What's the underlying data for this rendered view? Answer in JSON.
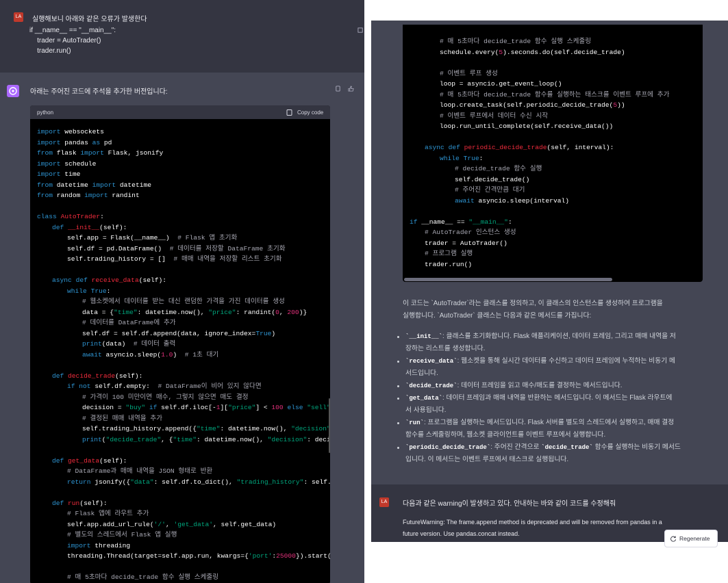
{
  "left": {
    "user_avatar": "LA",
    "user_message": [
      "실행해보니 아래와 같은 오류가 발생한다",
      "if __name__ == \"__main__\":",
      "    trader = AutoTrader()",
      "    trader.run()"
    ],
    "assistant_intro": "아래는 주어진 코드에 주석을 추가한 버전입니다:",
    "code_lang": "python",
    "copy_label": "Copy code"
  },
  "right": {
    "summary_para": [
      "이 코드는 `AutoTrader`라는 클래스를 정의하고, 이 클래스의 인스턴스를 생성하여 프로그램을",
      "실행합니다. `AutoTrader` 클래스는 다음과 같은 메서드를 가집니다:"
    ],
    "bullets": [
      [
        "`__init__`: 클래스를 초기화합니다. Flask 애플리케이션, 데이터 프레임, 그리고 매매 내역을 저",
        "장하는 리스트를 생성합니다."
      ],
      [
        "`receive_data`: 웹소켓을 통해 실시간 데이터를 수신하고 데이터 프레임에 누적하는 비동기 메",
        "서드입니다."
      ],
      [
        "`decide_trade`: 데이터 프레임을 읽고 매수/매도를 결정하는 메서드입니다."
      ],
      [
        "`get_data`: 데이터 프레임과 매매 내역을 반환하는 메서드입니다. 이 메서드는 Flask 라우트에",
        "서 사용됩니다."
      ],
      [
        "`run`: 프로그램을 실행하는 메서드입니다. Flask 서버를 별도의 스레드에서 실행하고, 매매 결정",
        "함수를 스케줄링하며, 웹소켓 클라이언트를 이벤트 루프에서 실행합니다."
      ],
      [
        "`periodic_decide_trade`: 주어진 간격으로 `decide_trade` 함수를 실행하는 비동기 메서드",
        "입니다. 이 메서드는 이벤트 루프에서 태스크로 실행됩니다."
      ]
    ],
    "user_avatar": "LA",
    "user_message": "다음과 같은 warning이 발생하고 있다. 안내하는 바와 같이 코드를 수정해줘",
    "warning_lines": [
      "FutureWarning: The frame.append method is deprecated and will be removed from pandas in a",
      "future version. Use pandas.concat instead."
    ],
    "regenerate_label": "Regenerate"
  }
}
